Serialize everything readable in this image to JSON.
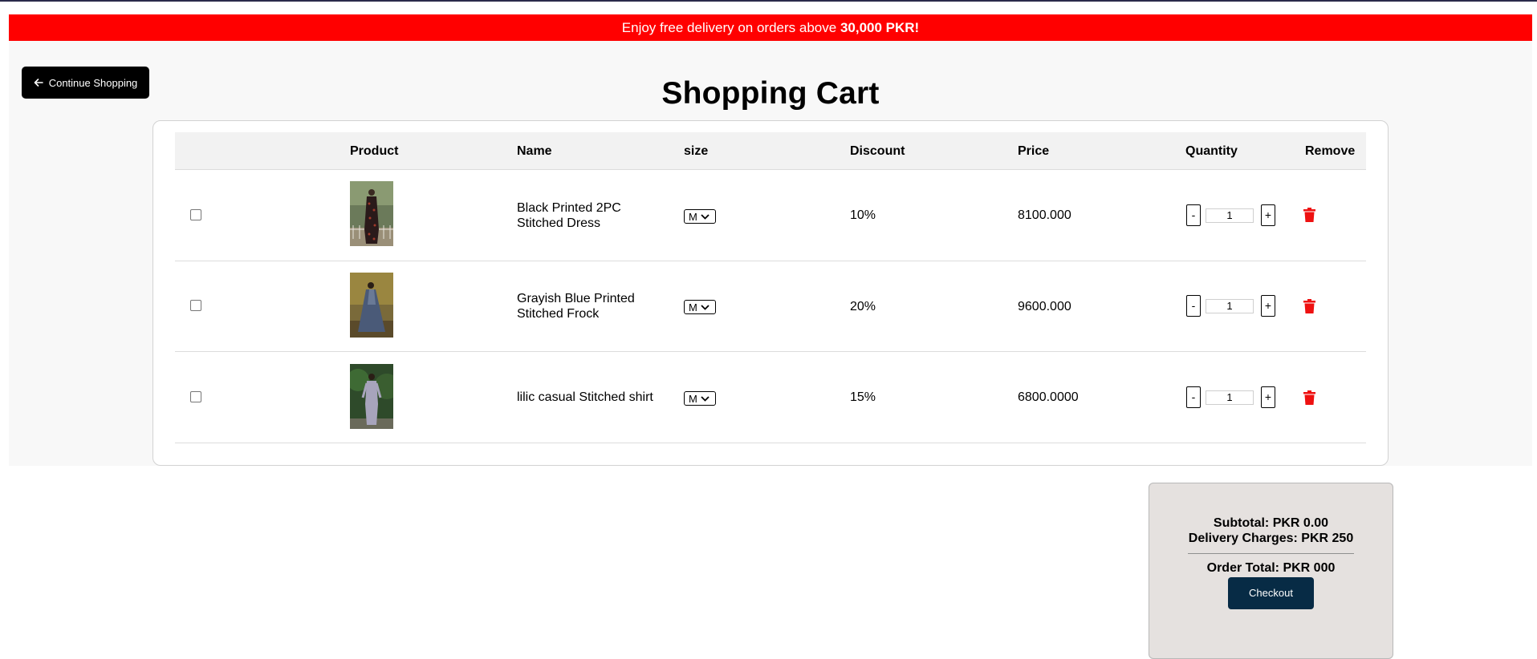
{
  "promo": {
    "text": "Enjoy free delivery on orders above ",
    "highlight": "30,000 PKR!"
  },
  "nav": {
    "continue_label": "Continue Shopping"
  },
  "page": {
    "title": "Shopping Cart"
  },
  "table": {
    "headers": {
      "product": "Product",
      "name": "Name",
      "size": "size",
      "discount": "Discount",
      "price": "Price",
      "quantity": "Quantity",
      "remove": "Remove"
    },
    "rows": [
      {
        "name": "Black Printed 2PC Stitched Dress",
        "size": "M",
        "discount": "10%",
        "price": "8100.000",
        "quantity": "1",
        "checked": false
      },
      {
        "name": "Grayish Blue Printed Stitched Frock",
        "size": "M",
        "discount": "20%",
        "price": "9600.000",
        "quantity": "1",
        "checked": false
      },
      {
        "name": "lilic casual Stitched shirt",
        "size": "M",
        "discount": "15%",
        "price": "6800.0000",
        "quantity": "1",
        "checked": false
      }
    ],
    "qty_minus": "-",
    "qty_plus": "+"
  },
  "summary": {
    "subtotal": "Subtotal: PKR 0.00",
    "delivery": "Delivery Charges: PKR 250",
    "total": "Order Total: PKR 000",
    "checkout_label": "Checkout"
  },
  "colors": {
    "promo_bg": "#ff0000",
    "checkout_bg": "#072b45",
    "trash": "#ee1111",
    "summary_bg": "#e5e1df"
  },
  "icons": {
    "back": "arrow-left-icon",
    "remove": "trash-icon",
    "size_dropdown": "chevron-down-icon"
  }
}
